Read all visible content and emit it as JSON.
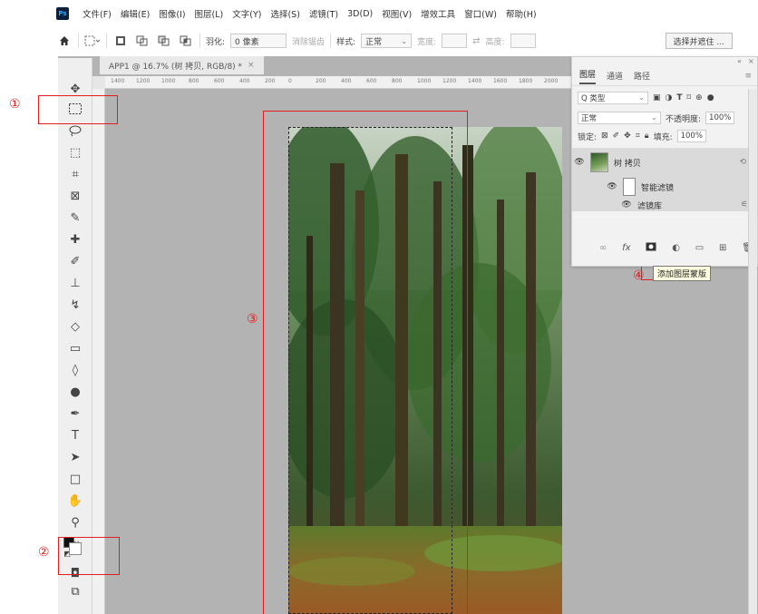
{
  "app": {
    "logo": "Ps"
  },
  "menu": [
    "文件(F)",
    "编辑(E)",
    "图像(I)",
    "图层(L)",
    "文字(Y)",
    "选择(S)",
    "滤镜(T)",
    "3D(D)",
    "视图(V)",
    "增效工具",
    "窗口(W)",
    "帮助(H)"
  ],
  "options": {
    "feather_label": "羽化:",
    "feather_value": "0 像素",
    "antialias": "消除锯齿",
    "style_label": "样式:",
    "style_value": "正常",
    "width_label": "宽度:",
    "height_label": "高度:",
    "select_mask": "选择并遮住 ..."
  },
  "document": {
    "tab_title": "APP1 @ 16.7% (树 拷贝, RGB/8) *",
    "close": "×"
  },
  "ruler": [
    "1400",
    "1200",
    "1000",
    "800",
    "600",
    "400",
    "200",
    "0",
    "200",
    "400",
    "600",
    "800",
    "1000",
    "1200",
    "1400",
    "1600",
    "1800",
    "2000"
  ],
  "layers_panel": {
    "tabs": [
      "图层",
      "通道",
      "路径"
    ],
    "filter_label": "Q 类型",
    "blend_mode": "正常",
    "opacity_label": "不透明度:",
    "opacity_value": "100%",
    "lock_label": "锁定:",
    "fill_label": "填充:",
    "fill_value": "100%",
    "layers": [
      {
        "name": "树 拷贝"
      },
      {
        "name": "智能滤镜"
      },
      {
        "name": "滤镜库"
      }
    ],
    "tooltip": "添加图层蒙版"
  },
  "annotations": [
    "①",
    "②",
    "③",
    "④"
  ],
  "colors": {
    "annotation_red": "#e02020",
    "workspace": "#b3b3b3"
  }
}
